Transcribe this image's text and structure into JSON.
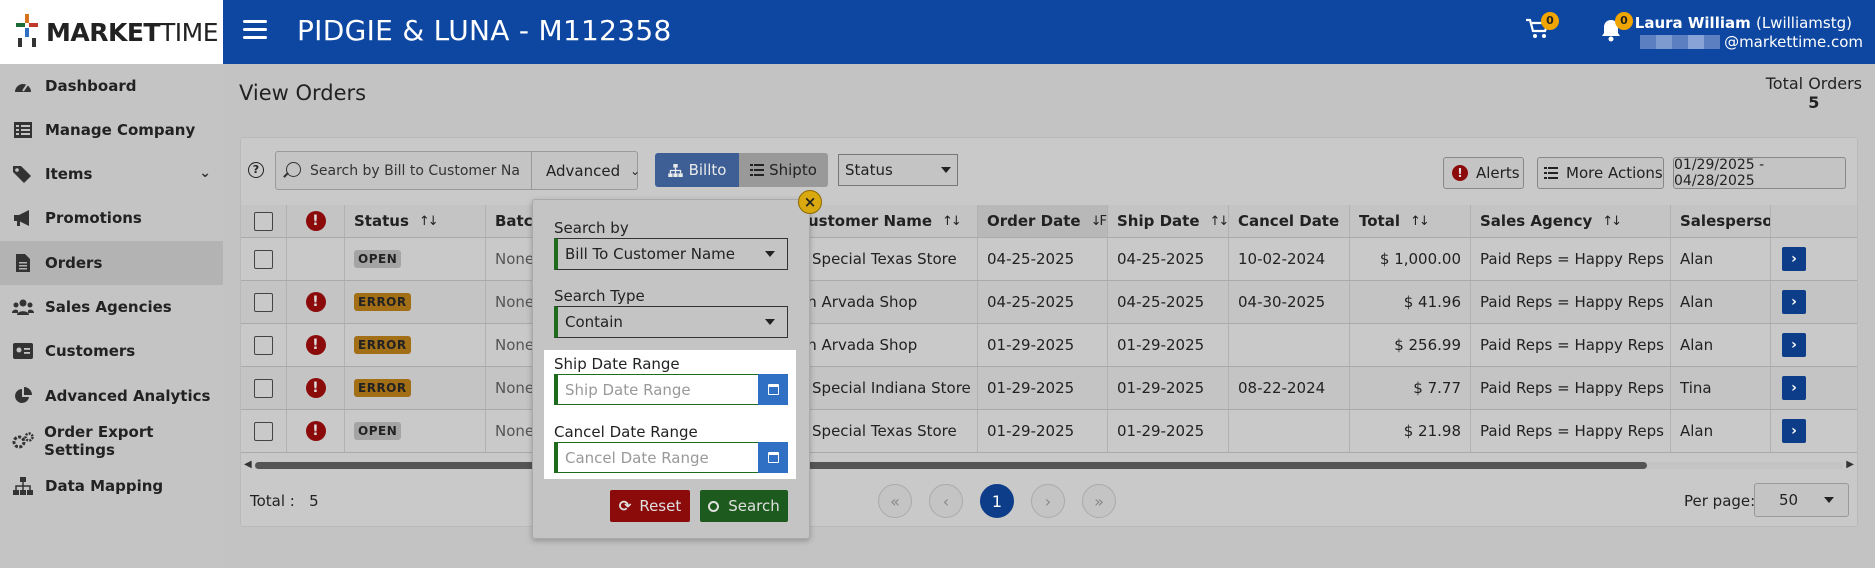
{
  "app": {
    "logo_bold": "MARKET",
    "logo_thin": "TIME",
    "page_heading": "PIDGIE & LUNA - M112358"
  },
  "header": {
    "cart_count": "0",
    "notification_count": "0",
    "user_name": "Laura William",
    "user_login": "(Lwilliamstg)",
    "user_email_suffix": "@markettime.com"
  },
  "sidebar": {
    "items": [
      {
        "label": "Dashboard",
        "icon": "dashboard-icon"
      },
      {
        "label": "Manage Company",
        "icon": "list-icon"
      },
      {
        "label": "Items",
        "icon": "tags-icon"
      },
      {
        "label": "Promotions",
        "icon": "megaphone-icon"
      },
      {
        "label": "Orders",
        "icon": "document-icon"
      },
      {
        "label": "Sales Agencies",
        "icon": "users-icon"
      },
      {
        "label": "Customers",
        "icon": "id-card-icon"
      },
      {
        "label": "Advanced Analytics",
        "icon": "pie-chart-icon"
      },
      {
        "label": "Order Export Settings",
        "icon": "gears-icon"
      },
      {
        "label": "Data Mapping",
        "icon": "sitemap-icon"
      }
    ],
    "active_item": "Orders"
  },
  "main": {
    "title": "View Orders",
    "total_orders_label": "Total Orders",
    "total_orders_value": "5"
  },
  "toolbar": {
    "help": "?",
    "search_placeholder": "Search by Bill to Customer Na",
    "advanced_label": "Advanced",
    "billto_label": "Billto",
    "shipto_label": "Shipto",
    "status_label": "Status",
    "alerts_label": "Alerts",
    "more_actions_label": "More Actions",
    "date_range": "01/29/2025 - 04/28/2025"
  },
  "table": {
    "columns": [
      "Status",
      "Batch",
      "Customer Name",
      "Order Date",
      "Ship Date",
      "Cancel Date",
      "Total",
      "Sales Agency",
      "Salesperson"
    ],
    "rows": [
      {
        "status": "OPEN",
        "error": false,
        "batch": "None",
        "customer": "A Special Texas Store",
        "order_date": "04-25-2025",
        "ship_date": "04-25-2025",
        "cancel_date": "10-02-2024",
        "total": "$ 1,000.00",
        "agency": "Paid Reps = Happy Reps",
        "salesperson": "Alan"
      },
      {
        "status": "ERROR",
        "error": true,
        "batch": "None",
        "customer": "An Arvada Shop",
        "order_date": "04-25-2025",
        "ship_date": "04-25-2025",
        "cancel_date": "04-30-2025",
        "total": "$ 41.96",
        "agency": "Paid Reps = Happy Reps",
        "salesperson": "Alan"
      },
      {
        "status": "ERROR",
        "error": true,
        "batch": "None",
        "customer": "An Arvada Shop",
        "order_date": "01-29-2025",
        "ship_date": "01-29-2025",
        "cancel_date": "",
        "total": "$ 256.99",
        "agency": "Paid Reps = Happy Reps",
        "salesperson": "Alan"
      },
      {
        "status": "ERROR",
        "error": true,
        "batch": "None",
        "customer": "A Special Indiana Store",
        "order_date": "01-29-2025",
        "ship_date": "01-29-2025",
        "cancel_date": "08-22-2024",
        "total": "$ 7.77",
        "agency": "Paid Reps = Happy Reps",
        "salesperson": "Tina"
      },
      {
        "status": "OPEN",
        "error": true,
        "batch": "None",
        "customer": "A Special Texas Store",
        "order_date": "01-29-2025",
        "ship_date": "01-29-2025",
        "cancel_date": "",
        "total": "$ 21.98",
        "agency": "Paid Reps = Happy Reps",
        "salesperson": "Alan"
      }
    ]
  },
  "footer": {
    "total_label": "Total :",
    "total_value": "5",
    "pages": {
      "first": "«",
      "prev": "‹",
      "current": "1",
      "next": "›",
      "last": "»"
    },
    "per_page_label": "Per page:",
    "per_page_value": "50"
  },
  "popup": {
    "close": "×",
    "search_by_label": "Search by",
    "search_by_value": "Bill To Customer Name",
    "search_type_label": "Search Type",
    "search_type_value": "Contain",
    "ship_date_label": "Ship Date Range",
    "ship_date_placeholder": "Ship Date Range",
    "cancel_date_label": "Cancel Date Range",
    "cancel_date_placeholder": "Cancel Date Range",
    "reset_label": "Reset",
    "search_label": "Search"
  }
}
